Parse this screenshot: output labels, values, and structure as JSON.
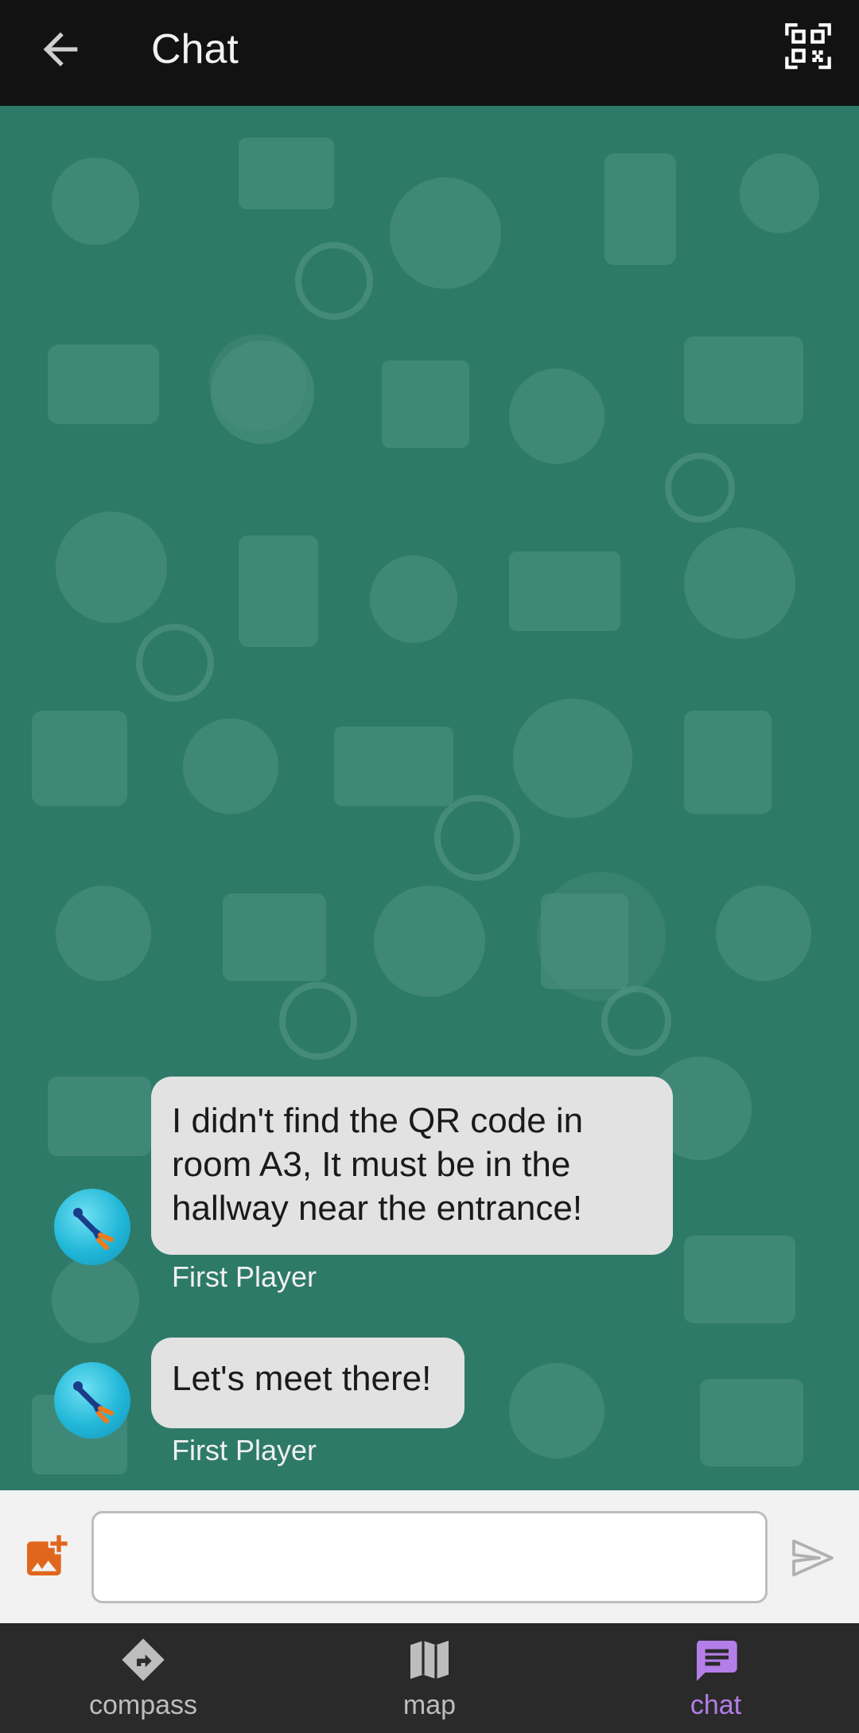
{
  "appbar": {
    "title": "Chat",
    "back_icon": "arrow-left-icon",
    "qr_icon": "qr-code-scan-icon"
  },
  "messages": [
    {
      "text": "I didn't find the QR code in room A3, It must be in the hallway near the entrance!",
      "lines": [
        "I didn't find the QR code in",
        "room A3, It must be in the",
        "hallway near the entrance!"
      ],
      "sender": "First Player"
    },
    {
      "text": "Let's meet there!",
      "lines": [
        "Let's meet there!"
      ],
      "sender": "First Player"
    }
  ],
  "composer": {
    "value": "",
    "placeholder": "",
    "attach_icon": "add-photo-icon",
    "send_icon": "send-icon"
  },
  "bottom_nav": {
    "items": [
      {
        "label": "compass",
        "icon": "compass-icon",
        "selected": false
      },
      {
        "label": "map",
        "icon": "map-icon",
        "selected": false
      },
      {
        "label": "chat",
        "icon": "chat-icon",
        "selected": true
      }
    ]
  },
  "colors": {
    "appbar_bg": "#121212",
    "chat_bg": "#2e7a68",
    "bubble_bg": "#e2e2e2",
    "accent": "#b47ee8",
    "attach_accent": "#e0661e",
    "nav_bg": "#2a2a2a",
    "nav_inactive": "#bdbdbd"
  }
}
